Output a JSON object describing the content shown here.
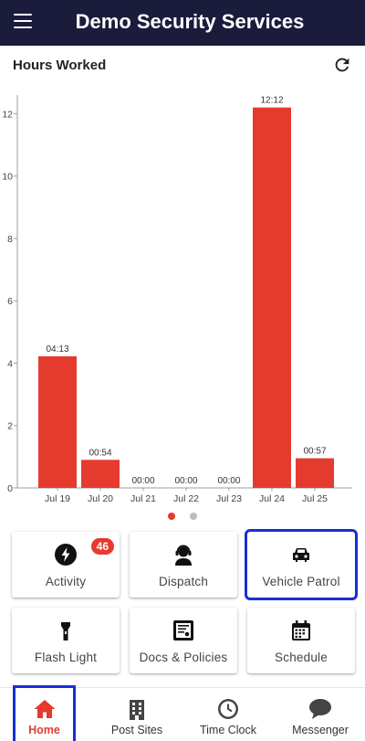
{
  "app": {
    "title": "Demo Security Services"
  },
  "section": {
    "title": "Hours Worked"
  },
  "chart_data": {
    "type": "bar",
    "categories": [
      "Jul 19",
      "Jul 20",
      "Jul 21",
      "Jul 22",
      "Jul 23",
      "Jul 24",
      "Jul 25"
    ],
    "values": [
      4.22,
      0.9,
      0,
      0,
      0,
      12.2,
      0.95
    ],
    "data_labels": [
      "04:13",
      "00:54",
      "00:00",
      "00:00",
      "00:00",
      "12:12",
      "00:57"
    ],
    "yticks": [
      0,
      2,
      4,
      6,
      8,
      10,
      12
    ],
    "ylim": [
      0,
      12.6
    ],
    "bar_color": "#e53a2e",
    "grid": false
  },
  "pager": {
    "count": 2,
    "active": 0
  },
  "tiles": [
    {
      "label": "Activity",
      "icon": "lightning-icon",
      "badge": "46"
    },
    {
      "label": "Dispatch",
      "icon": "headset-agent-icon"
    },
    {
      "label": "Vehicle Patrol",
      "icon": "car-icon",
      "highlighted": true
    },
    {
      "label": "Flash Light",
      "icon": "flashlight-icon"
    },
    {
      "label": "Docs & Policies",
      "icon": "document-icon"
    },
    {
      "label": "Schedule",
      "icon": "calendar-icon"
    }
  ],
  "nav": [
    {
      "label": "Home",
      "icon": "home-icon",
      "active": true
    },
    {
      "label": "Post Sites",
      "icon": "building-icon"
    },
    {
      "label": "Time Clock",
      "icon": "clock-icon"
    },
    {
      "label": "Messenger",
      "icon": "chat-bubble-icon"
    }
  ],
  "colors": {
    "appbar": "#1b1b3c",
    "accent": "#e53a2e",
    "highlight": "#1a2ed6"
  }
}
